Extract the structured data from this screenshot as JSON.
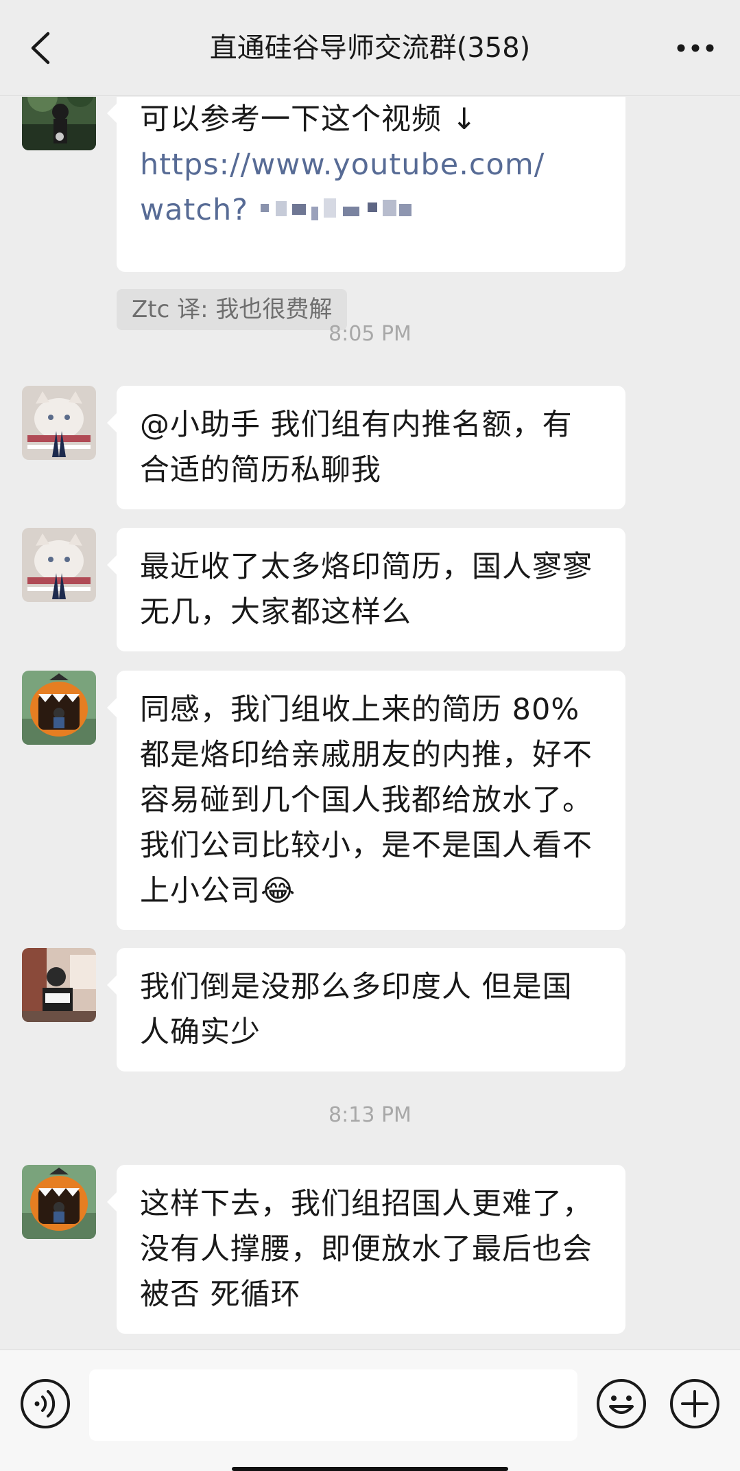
{
  "header": {
    "title": "直通硅谷导师交流群(358)",
    "back_icon": "chevron-left-icon",
    "more_icon": "more-dots-icon"
  },
  "messages": [
    {
      "text": "可以参考一下这个视频 ↓",
      "link_line1": "https://www.youtube.com/",
      "link_line2": "watch?",
      "translation": "Ztc 译: 我也很费解"
    },
    {
      "time": "8:05 PM"
    },
    {
      "text": "@小助手 我们组有内推名额，有合适的简历私聊我"
    },
    {
      "text": "最近收了太多烙印简历，国人寥寥无几，大家都这样么"
    },
    {
      "text": "同感，我门组收上来的简历 80% 都是烙印给亲戚朋友的内推，好不容易碰到几个国人我都给放水了。我们公司比较小，是不是国人看不上小公司😂"
    },
    {
      "text": "我们倒是没那么多印度人  但是国人确实少"
    },
    {
      "time": "8:13 PM"
    },
    {
      "text": "这样下去，我们组招国人更难了，没有人撑腰，即便放水了最后也会被否  死循环"
    }
  ],
  "input": {
    "value": "",
    "voice_icon": "voice-icon",
    "emoji_icon": "emoji-icon",
    "plus_icon": "plus-icon"
  },
  "colors": {
    "background": "#ededed",
    "bubble": "#ffffff",
    "link": "#576b95",
    "timestamp": "#a8a8a8"
  }
}
